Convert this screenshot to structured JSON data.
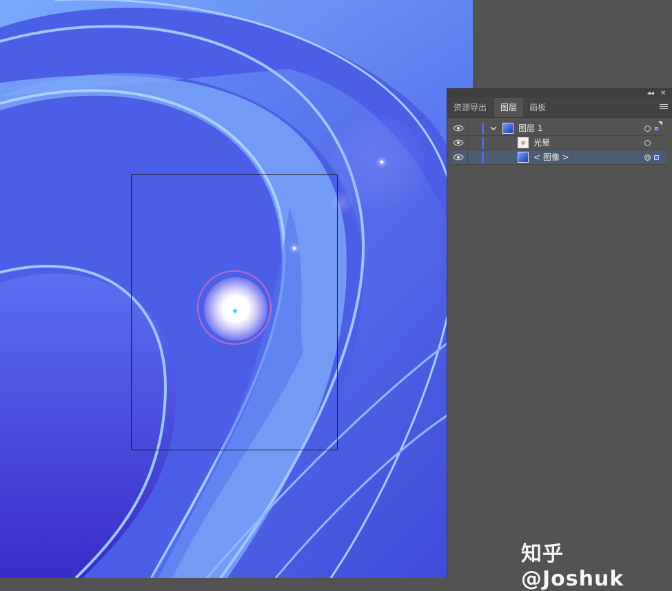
{
  "panel": {
    "tabs": [
      {
        "label": "资源导出",
        "active": false
      },
      {
        "label": "图层",
        "active": true
      },
      {
        "label": "画板",
        "active": false
      }
    ],
    "collapse_icon": "double-chevron-left-icon",
    "close_icon": "close-icon",
    "menu_icon": "hamburger-menu-icon",
    "layers": [
      {
        "name": "图层 1",
        "kind": "layer",
        "expanded": true,
        "selected": false
      },
      {
        "name": "光晕",
        "kind": "flare",
        "selected": false
      },
      {
        "name": "< 图像 >",
        "kind": "image",
        "selected": true
      }
    ]
  },
  "watermark": "知乎 @Joshuk",
  "colors": {
    "panel_bg": "#535353",
    "tab_bg": "#424242",
    "selected_row": "#4c5d73",
    "layer_color": "#4a6ee8",
    "flare_ring": "#e66ebe",
    "flare_center": "#28d6ff"
  }
}
